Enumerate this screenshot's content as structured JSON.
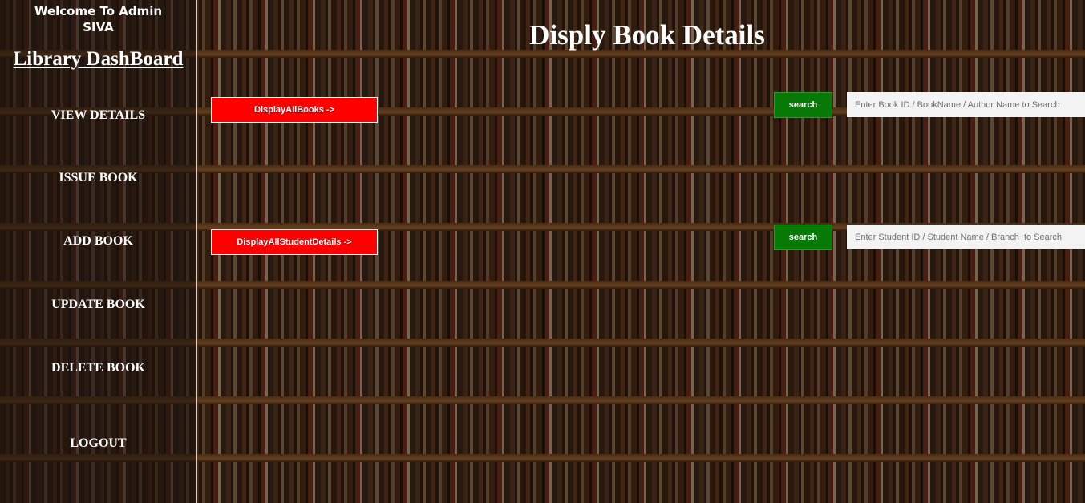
{
  "sidebar": {
    "welcome_line1": "Welcome To Admin",
    "welcome_line2": "SIVA",
    "title": "Library DashBoard",
    "items": [
      {
        "label": "VIEW DETAILS"
      },
      {
        "label": "ISSUE BOOK"
      },
      {
        "label": "ADD BOOK"
      },
      {
        "label": "UPDATE BOOK"
      },
      {
        "label": "DELETE BOOK"
      },
      {
        "label": "LOGOUT"
      }
    ]
  },
  "main": {
    "title": "Disply Book Details",
    "books_section": {
      "display_button": "DisplayAllBooks ->",
      "search_button": "search",
      "search_placeholder": "Enter Book ID / BookName / Author Name to Search",
      "search_value": ""
    },
    "students_section": {
      "display_button": "DisplayAllStudentDetails ->",
      "search_button": "search",
      "search_placeholder": "Enter Student ID / Student Name / Branch  to Search",
      "search_value": ""
    }
  },
  "colors": {
    "display_button_bg": "#ff0000",
    "search_button_bg": "#077a07",
    "text": "#ffffff"
  }
}
